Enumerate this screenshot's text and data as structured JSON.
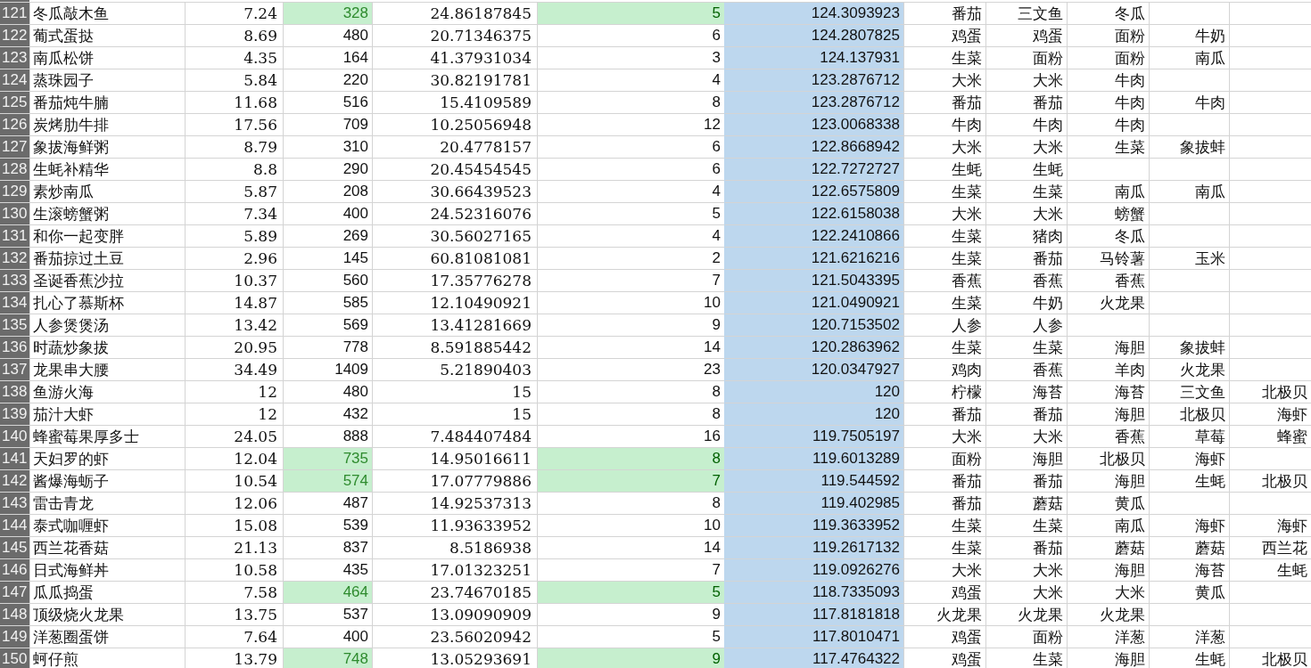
{
  "rows": [
    {
      "num": "121",
      "name": "冬瓜敲木鱼",
      "b": "7.24",
      "c": "328",
      "d": "24.86187845",
      "e": "5",
      "f": "124.3093923",
      "f_selected": true,
      "highlighted": true,
      "ingredients": [
        "番茄",
        "三文鱼",
        "冬瓜"
      ]
    },
    {
      "num": "122",
      "name": "葡式蛋挞",
      "b": "8.69",
      "c": "480",
      "d": "20.71346375",
      "e": "6",
      "f": "124.2807825",
      "f_selected": true,
      "highlighted": false,
      "ingredients": [
        "鸡蛋",
        "鸡蛋",
        "面粉",
        "牛奶"
      ]
    },
    {
      "num": "123",
      "name": "南瓜松饼",
      "b": "4.35",
      "c": "164",
      "d": "41.37931034",
      "e": "3",
      "f": "124.137931",
      "f_selected": true,
      "highlighted": false,
      "ingredients": [
        "生菜",
        "面粉",
        "面粉",
        "南瓜"
      ]
    },
    {
      "num": "124",
      "name": "蒸珠园子",
      "b": "5.84",
      "c": "220",
      "d": "30.82191781",
      "e": "4",
      "f": "123.2876712",
      "f_selected": true,
      "highlighted": false,
      "ingredients": [
        "大米",
        "大米",
        "牛肉"
      ]
    },
    {
      "num": "125",
      "name": "番茄炖牛腩",
      "b": "11.68",
      "c": "516",
      "d": "15.4109589",
      "e": "8",
      "f": "123.2876712",
      "f_selected": true,
      "highlighted": false,
      "ingredients": [
        "番茄",
        "番茄",
        "牛肉",
        "牛肉"
      ]
    },
    {
      "num": "126",
      "name": "炭烤肋牛排",
      "b": "17.56",
      "c": "709",
      "d": "10.25056948",
      "e": "12",
      "f": "123.0068338",
      "f_selected": true,
      "highlighted": false,
      "ingredients": [
        "牛肉",
        "牛肉",
        "牛肉"
      ]
    },
    {
      "num": "127",
      "name": "象拔海鲜粥",
      "b": "8.79",
      "c": "310",
      "d": "20.4778157",
      "e": "6",
      "f": "122.8668942",
      "f_selected": true,
      "highlighted": false,
      "ingredients": [
        "大米",
        "大米",
        "生菜",
        "象拔蚌"
      ]
    },
    {
      "num": "128",
      "name": "生蚝补精华",
      "b": "8.8",
      "c": "290",
      "d": "20.45454545",
      "e": "6",
      "f": "122.7272727",
      "f_selected": true,
      "highlighted": false,
      "ingredients": [
        "生蚝",
        "生蚝"
      ]
    },
    {
      "num": "129",
      "name": "素炒南瓜",
      "b": "5.87",
      "c": "208",
      "d": "30.66439523",
      "e": "4",
      "f": "122.6575809",
      "f_selected": true,
      "highlighted": false,
      "ingredients": [
        "生菜",
        "生菜",
        "南瓜",
        "南瓜"
      ]
    },
    {
      "num": "130",
      "name": "生滚螃蟹粥",
      "b": "7.34",
      "c": "400",
      "d": "24.52316076",
      "e": "5",
      "f": "122.6158038",
      "f_selected": true,
      "highlighted": false,
      "ingredients": [
        "大米",
        "大米",
        "螃蟹"
      ]
    },
    {
      "num": "131",
      "name": "和你一起变胖",
      "b": "5.89",
      "c": "269",
      "d": "30.56027165",
      "e": "4",
      "f": "122.2410866",
      "f_selected": true,
      "highlighted": false,
      "ingredients": [
        "生菜",
        "猪肉",
        "冬瓜"
      ]
    },
    {
      "num": "132",
      "name": "番茄掠过土豆",
      "b": "2.96",
      "c": "145",
      "d": "60.81081081",
      "e": "2",
      "f": "121.6216216",
      "f_selected": true,
      "highlighted": false,
      "ingredients": [
        "生菜",
        "番茄",
        "马铃薯",
        "玉米"
      ]
    },
    {
      "num": "133",
      "name": "圣诞香蕉沙拉",
      "b": "10.37",
      "c": "560",
      "d": "17.35776278",
      "e": "7",
      "f": "121.5043395",
      "f_selected": true,
      "highlighted": false,
      "ingredients": [
        "香蕉",
        "香蕉",
        "香蕉"
      ]
    },
    {
      "num": "134",
      "name": "扎心了慕斯杯",
      "b": "14.87",
      "c": "585",
      "d": "12.10490921",
      "e": "10",
      "f": "121.0490921",
      "f_selected": true,
      "highlighted": false,
      "ingredients": [
        "生菜",
        "牛奶",
        "火龙果"
      ]
    },
    {
      "num": "135",
      "name": "人参煲煲汤",
      "b": "13.42",
      "c": "569",
      "d": "13.41281669",
      "e": "9",
      "f": "120.7153502",
      "f_selected": true,
      "highlighted": false,
      "ingredients": [
        "人参",
        "人参"
      ]
    },
    {
      "num": "136",
      "name": "时蔬炒象拔",
      "b": "20.95",
      "c": "778",
      "d": "8.591885442",
      "e": "14",
      "f": "120.2863962",
      "f_selected": true,
      "highlighted": false,
      "ingredients": [
        "生菜",
        "生菜",
        "海胆",
        "象拔蚌"
      ]
    },
    {
      "num": "137",
      "name": "龙果串大腰",
      "b": "34.49",
      "c": "1409",
      "d": "5.21890403",
      "e": "23",
      "f": "120.0347927",
      "f_selected": true,
      "highlighted": false,
      "ingredients": [
        "鸡肉",
        "香蕉",
        "羊肉",
        "火龙果"
      ]
    },
    {
      "num": "138",
      "name": "鱼游火海",
      "b": "12",
      "c": "480",
      "d": "15",
      "e": "8",
      "f": "120",
      "f_selected": true,
      "highlighted": false,
      "ingredients": [
        "柠檬",
        "海苔",
        "海苔",
        "三文鱼",
        "北极贝"
      ]
    },
    {
      "num": "139",
      "name": "茄汁大虾",
      "b": "12",
      "c": "432",
      "d": "15",
      "e": "8",
      "f": "120",
      "f_selected": true,
      "highlighted": false,
      "ingredients": [
        "番茄",
        "番茄",
        "海胆",
        "北极贝",
        "海虾"
      ]
    },
    {
      "num": "140",
      "name": "蜂蜜莓果厚多士",
      "b": "24.05",
      "c": "888",
      "d": "7.484407484",
      "e": "16",
      "f": "119.7505197",
      "f_selected": true,
      "highlighted": false,
      "ingredients": [
        "大米",
        "大米",
        "香蕉",
        "草莓",
        "蜂蜜"
      ]
    },
    {
      "num": "141",
      "name": "天妇罗的虾",
      "b": "12.04",
      "c": "735",
      "d": "14.95016611",
      "e": "8",
      "f": "119.6013289",
      "f_selected": true,
      "highlighted": true,
      "ingredients": [
        "面粉",
        "海胆",
        "北极贝",
        "海虾"
      ]
    },
    {
      "num": "142",
      "name": "酱爆海蛎子",
      "b": "10.54",
      "c": "574",
      "d": "17.07779886",
      "e": "7",
      "f": "119.544592",
      "f_selected": true,
      "highlighted": true,
      "ingredients": [
        "番茄",
        "番茄",
        "海胆",
        "生蚝",
        "北极贝"
      ]
    },
    {
      "num": "143",
      "name": "雷击青龙",
      "b": "12.06",
      "c": "487",
      "d": "14.92537313",
      "e": "8",
      "f": "119.402985",
      "f_selected": true,
      "highlighted": false,
      "ingredients": [
        "番茄",
        "蘑菇",
        "黄瓜"
      ]
    },
    {
      "num": "144",
      "name": "泰式咖喱虾",
      "b": "15.08",
      "c": "539",
      "d": "11.93633952",
      "e": "10",
      "f": "119.3633952",
      "f_selected": true,
      "highlighted": false,
      "ingredients": [
        "生菜",
        "生菜",
        "南瓜",
        "海虾",
        "海虾"
      ]
    },
    {
      "num": "145",
      "name": "西兰花香菇",
      "b": "21.13",
      "c": "837",
      "d": "8.5186938",
      "e": "14",
      "f": "119.2617132",
      "f_selected": true,
      "highlighted": false,
      "ingredients": [
        "生菜",
        "番茄",
        "蘑菇",
        "蘑菇",
        "西兰花"
      ]
    },
    {
      "num": "146",
      "name": "日式海鲜丼",
      "b": "10.58",
      "c": "435",
      "d": "17.01323251",
      "e": "7",
      "f": "119.0926276",
      "f_selected": true,
      "highlighted": false,
      "ingredients": [
        "大米",
        "大米",
        "海胆",
        "海苔",
        "生蚝"
      ]
    },
    {
      "num": "147",
      "name": "瓜瓜捣蛋",
      "b": "7.58",
      "c": "464",
      "d": "23.74670185",
      "e": "5",
      "f": "118.7335093",
      "f_selected": true,
      "highlighted": true,
      "ingredients": [
        "鸡蛋",
        "大米",
        "大米",
        "黄瓜"
      ]
    },
    {
      "num": "148",
      "name": "顶级烧火龙果",
      "b": "13.75",
      "c": "537",
      "d": "13.09090909",
      "e": "9",
      "f": "117.8181818",
      "f_selected": true,
      "highlighted": false,
      "ingredients": [
        "火龙果",
        "火龙果",
        "火龙果"
      ]
    },
    {
      "num": "149",
      "name": "洋葱圈蛋饼",
      "b": "7.64",
      "c": "400",
      "d": "23.56020942",
      "e": "5",
      "f": "117.8010471",
      "f_selected": true,
      "highlighted": false,
      "ingredients": [
        "鸡蛋",
        "面粉",
        "洋葱",
        "洋葱"
      ]
    },
    {
      "num": "150",
      "name": "蚵仔煎",
      "b": "13.79",
      "c": "748",
      "d": "13.05293691",
      "e": "9",
      "f": "117.4764322",
      "f_selected": true,
      "highlighted": true,
      "ingredients": [
        "鸡蛋",
        "生菜",
        "海胆",
        "生蚝",
        "北极贝"
      ]
    }
  ]
}
